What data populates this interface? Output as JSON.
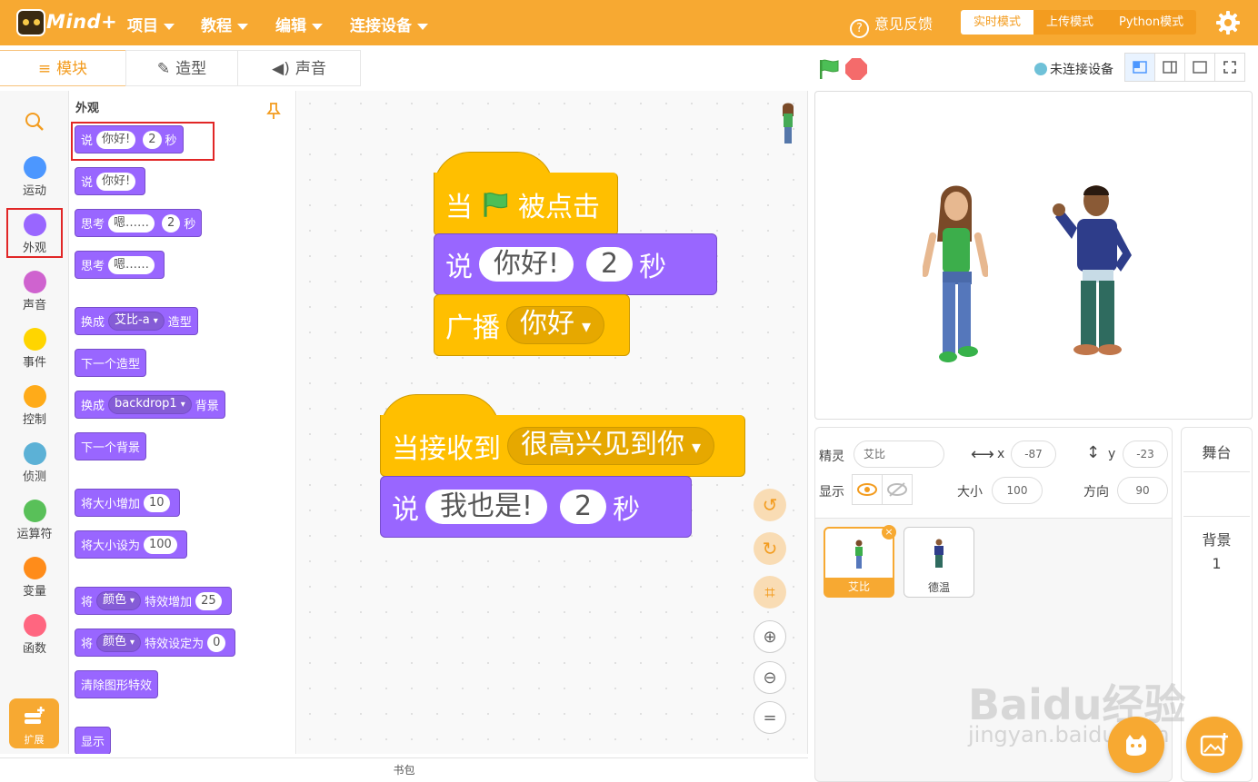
{
  "app": {
    "logo_text": "Mind+"
  },
  "menu": {
    "project": "项目",
    "tutorial": "教程",
    "edit": "编辑",
    "connect": "连接设备"
  },
  "topbar": {
    "feedback": "意见反馈",
    "modes": [
      "实时模式",
      "上传模式",
      "Python模式"
    ],
    "active_mode": "实时模式"
  },
  "tabs": {
    "blocks": "模块",
    "costumes": "造型",
    "sounds": "声音"
  },
  "stage_controls": {
    "connection_status": "未连接设备"
  },
  "categories": [
    {
      "label": "运动",
      "color": "#4c97ff"
    },
    {
      "label": "外观",
      "color": "#9966ff"
    },
    {
      "label": "声音",
      "color": "#cf63cf"
    },
    {
      "label": "事件",
      "color": "#ffd500"
    },
    {
      "label": "控制",
      "color": "#ffab19"
    },
    {
      "label": "侦测",
      "color": "#5cb1d6"
    },
    {
      "label": "运算符",
      "color": "#59c059"
    },
    {
      "label": "变量",
      "color": "#ff8c1a"
    },
    {
      "label": "函数",
      "color": "#ff6680"
    }
  ],
  "extensions": {
    "label": "扩展"
  },
  "palette": {
    "title": "外观",
    "say_secs": {
      "say": "说",
      "msg": "你好!",
      "secs": "2",
      "unit": "秒"
    },
    "say": {
      "say": "说",
      "msg": "你好!"
    },
    "think_secs": {
      "think": "思考",
      "msg": "嗯……",
      "secs": "2",
      "unit": "秒"
    },
    "think": {
      "think": "思考",
      "msg": "嗯……"
    },
    "switch_costume": {
      "pre": "换成",
      "val": "艾比-a",
      "post": "造型"
    },
    "next_costume": "下一个造型",
    "switch_backdrop": {
      "pre": "换成",
      "val": "backdrop1",
      "post": "背景"
    },
    "next_backdrop": "下一个背景",
    "change_size": {
      "label": "将大小增加",
      "val": "10"
    },
    "set_size": {
      "label": "将大小设为",
      "val": "100"
    },
    "change_effect": {
      "pre": "将",
      "effect": "颜色",
      "mid": "特效增加",
      "val": "25"
    },
    "set_effect": {
      "pre": "将",
      "effect": "颜色",
      "mid": "特效设定为",
      "val": "0"
    },
    "clear_effects": "清除图形特效",
    "show": "显示"
  },
  "script1": {
    "when_pre": "当",
    "when_post": "被点击",
    "say": "说",
    "msg": "你好!",
    "secs": "2",
    "unit": "秒",
    "broadcast": "广播",
    "broadcast_msg": "你好"
  },
  "script2": {
    "receive": "当接收到",
    "receive_msg": "很高兴见到你",
    "say": "说",
    "msg": "我也是!",
    "secs": "2",
    "unit": "秒"
  },
  "backpack": "书包",
  "sprite_info": {
    "sprite_label": "精灵",
    "sprite_name": "艾比",
    "x_label": "x",
    "x": "-87",
    "y_label": "y",
    "y": "-23",
    "show_label": "显示",
    "size_label": "大小",
    "size": "100",
    "direction_label": "方向",
    "direction": "90"
  },
  "sprites": [
    {
      "name": "艾比"
    },
    {
      "name": "德温"
    }
  ],
  "stage_pane": {
    "title": "舞台",
    "backdrop_label": "背景",
    "backdrop_count": "1"
  },
  "watermark": {
    "line1": "Baidu经验",
    "line2": "jingyan.baidu.com"
  }
}
